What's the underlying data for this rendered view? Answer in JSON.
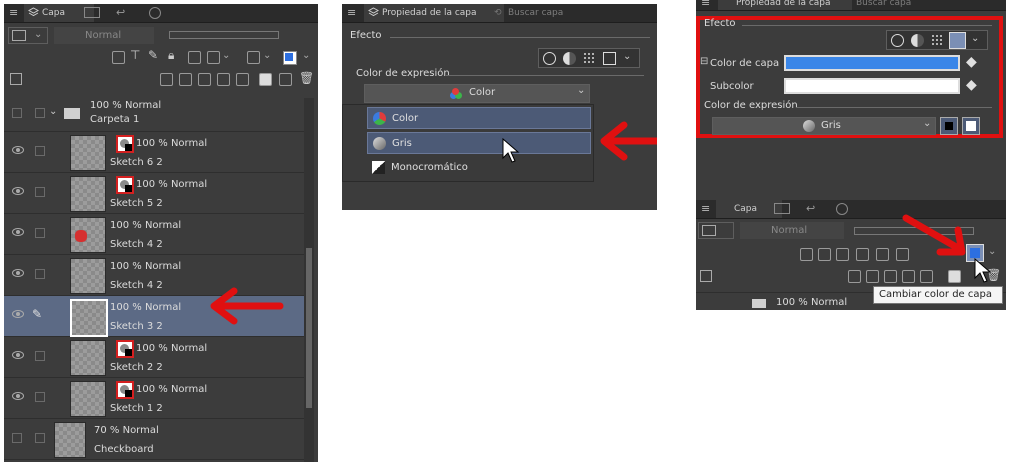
{
  "panel1": {
    "tab_layer": "Capa",
    "blend_mode": "Normal",
    "layers": [
      {
        "opacity": "100 % Normal",
        "name": "Carpeta 1",
        "type": "folder"
      },
      {
        "opacity": "100 % Normal",
        "name": "Sketch 6  2",
        "type": "color"
      },
      {
        "opacity": "100 % Normal",
        "name": "Sketch 5 2",
        "type": "color"
      },
      {
        "opacity": "100 % Normal",
        "name": "Sketch 4 2",
        "type": "plain"
      },
      {
        "opacity": "100 % Normal",
        "name": "Sketch 4 2",
        "type": "plain"
      },
      {
        "opacity": "100 % Normal",
        "name": "Sketch 3 2",
        "type": "plain",
        "selected": true
      },
      {
        "opacity": "100 % Normal",
        "name": "Sketch 2 2",
        "type": "color"
      },
      {
        "opacity": "100 % Normal",
        "name": "Sketch 1 2",
        "type": "color"
      },
      {
        "opacity": "70 % Normal",
        "name": "Checkboard",
        "type": "plain"
      }
    ]
  },
  "panel2": {
    "tab_property": "Propiedad de la capa",
    "tab_search": "Buscar capa",
    "effect_label": "Efecto",
    "expression_label": "Color de expresión",
    "expression_value": "Color",
    "menu": [
      {
        "label": "Color",
        "icon": "color-dots-icon"
      },
      {
        "label": "Gris",
        "icon": "gray-circle-icon"
      },
      {
        "label": "Monocromático",
        "icon": "mono-icon"
      }
    ]
  },
  "panel3": {
    "tab_property": "Propiedad de la capa",
    "tab_search": "Buscar capa",
    "effect_label": "Efecto",
    "layer_color_label": "Color de capa",
    "subcolor_label": "Subcolor",
    "expression_label": "Color de expresión",
    "expression_value": "Gris",
    "layer_color": "#3a86e8",
    "subcolor": "#ffffff",
    "tab_layer": "Capa",
    "blend_mode": "Normal",
    "tooltip": "Cambiar color de capa",
    "bottom_layer": "100 % Normal"
  }
}
